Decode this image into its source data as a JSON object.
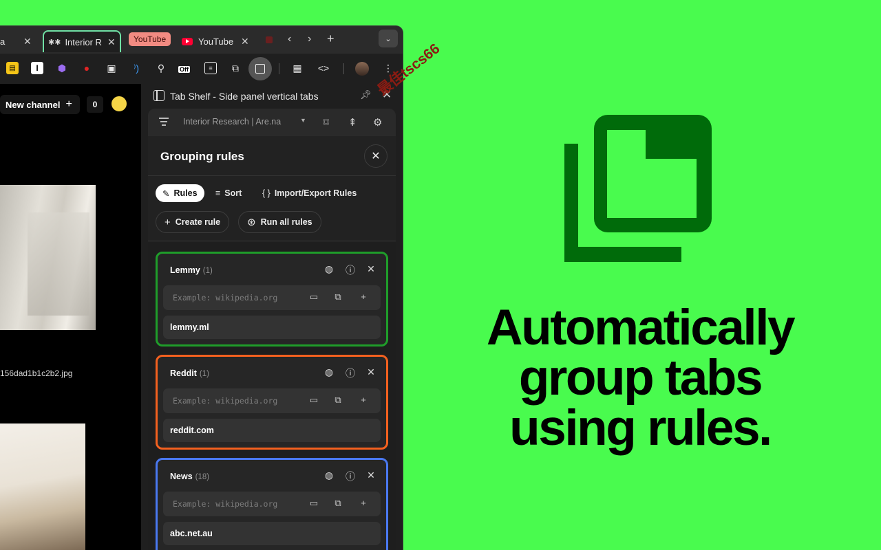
{
  "browser": {
    "tabs": [
      {
        "label": "a"
      },
      {
        "label": "Interior R"
      },
      {
        "label": "YouTube"
      },
      {
        "label": "YouTube"
      }
    ],
    "tab_group_label": "YouTube",
    "extensions_badge_off": "Off"
  },
  "page": {
    "new_channel_label": "New channel",
    "count": "0",
    "filename": "156dad1b1c2b2.jpg"
  },
  "side_panel": {
    "title": "Tab Shelf - Side panel vertical tabs",
    "workspace": "Interior Research | Are.na"
  },
  "modal": {
    "title": "Grouping rules",
    "tabs": [
      {
        "label": "Rules",
        "active": true
      },
      {
        "label": "Sort"
      },
      {
        "label": "Import/Export Rules"
      }
    ],
    "create_rule_label": "Create rule",
    "run_all_label": "Run all rules",
    "input_placeholder": "Example: wikipedia.org",
    "rules": [
      {
        "name": "Lemmy",
        "count": "(1)",
        "url": "lemmy.ml",
        "color": "#1f9d2a"
      },
      {
        "name": "Reddit",
        "count": "(1)",
        "url": "reddit.com",
        "color": "#f4611f"
      },
      {
        "name": "News",
        "count": "(18)",
        "url": "abc.net.au",
        "color": "#4a78f0"
      }
    ]
  },
  "hero": {
    "line1": "Automatically",
    "line2": "group tabs",
    "line3": "using rules.",
    "accent": "#49fb4e",
    "icon_color": "#006b0a"
  },
  "watermark": "最佳tscs66"
}
